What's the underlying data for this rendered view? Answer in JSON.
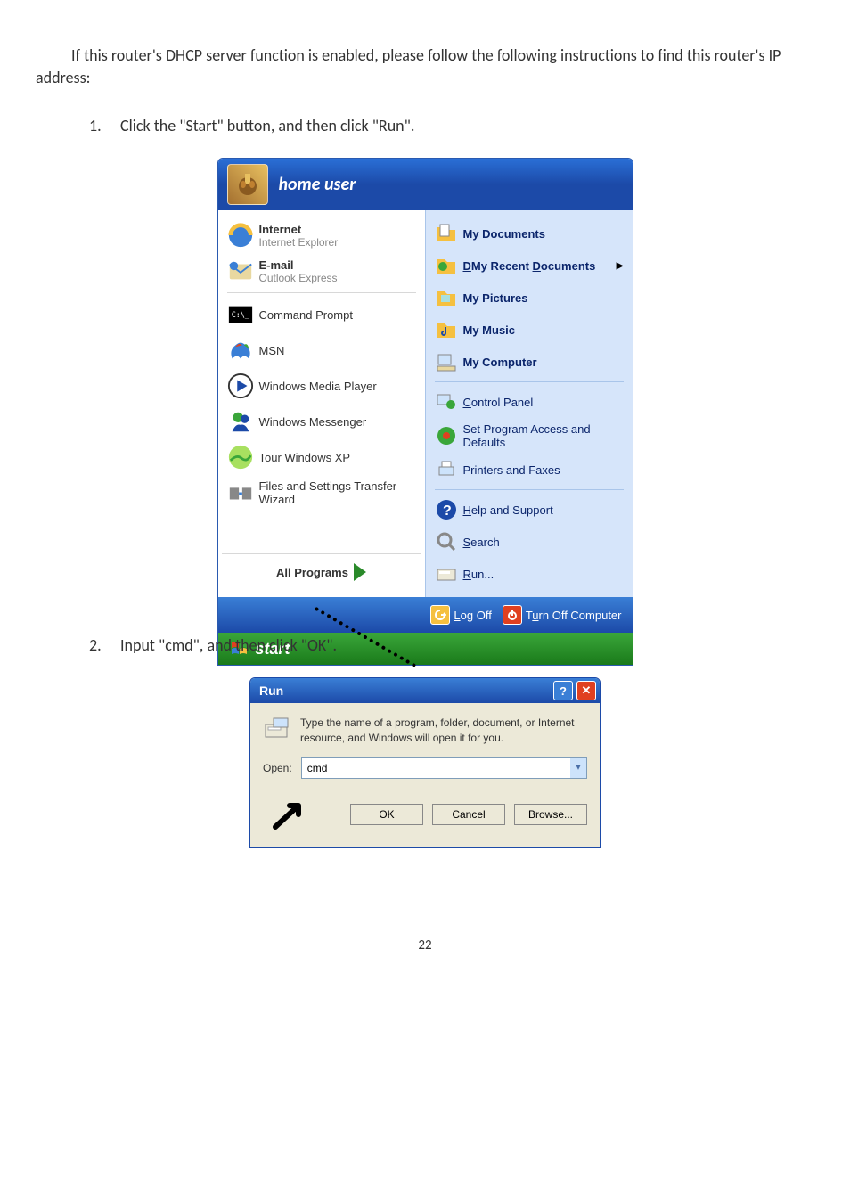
{
  "intro": "If this router's DHCP server function is enabled, please follow the following instructions to find this router's IP address:",
  "steps": {
    "s1": {
      "num": "1.",
      "text": "Click the \"Start\" button, and then click \"Run\"."
    },
    "s2": {
      "num": "2.",
      "text": "Input \"cmd\", and then click \"OK\"."
    }
  },
  "startmenu": {
    "username": "home user",
    "left": {
      "internet": {
        "title": "Internet",
        "sub": "Internet Explorer"
      },
      "email": {
        "title": "E-mail",
        "sub": "Outlook Express"
      },
      "cmd": "Command Prompt",
      "msn": "MSN",
      "wmp": "Windows Media Player",
      "wmsg": "Windows Messenger",
      "tour": "Tour Windows XP",
      "fst": "Files and Settings Transfer Wizard",
      "allprograms": "All Programs"
    },
    "right": {
      "mydocs": "My Documents",
      "myrecent": "My Recent Documents",
      "mypics": "My Pictures",
      "mymusic": "My Music",
      "mycomp": "My Computer",
      "cpanel": "Control Panel",
      "setprog": "Set Program Access and Defaults",
      "printers": "Printers and Faxes",
      "help": "Help and Support",
      "search": "Search",
      "run": "Run..."
    },
    "footer": {
      "logoff": "Log Off",
      "turnoff": "Turn Off Computer"
    },
    "startbutton": "start"
  },
  "run": {
    "title": "Run",
    "desc": "Type the name of a program, folder, document, or Internet resource, and Windows will open it for you.",
    "open_label": "Open:",
    "open_value": "cmd",
    "ok": "OK",
    "cancel": "Cancel",
    "browse": "Browse..."
  },
  "page_number": "22"
}
